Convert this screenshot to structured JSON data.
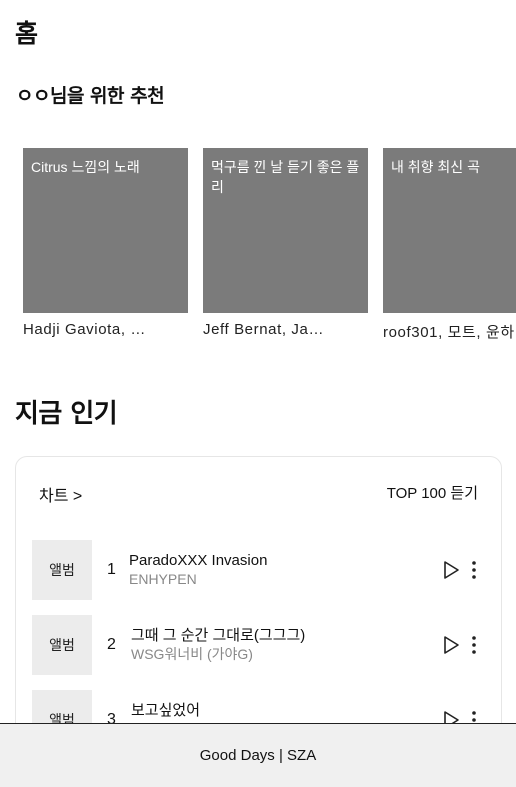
{
  "page": {
    "title": "홈"
  },
  "recommend": {
    "title": "ㅇㅇ님을 위한 추천",
    "cards": [
      {
        "cover_text": "Citrus 느낌의 노래",
        "artists": "Hadji Gaviota, Gentle Bones"
      },
      {
        "cover_text": "먹구름 낀 날 듣기 좋은 플리",
        "artists": "Jeff Bernat, Jack Johnson"
      },
      {
        "cover_text": "내 취향 최신 곡",
        "artists": "roof301, 모트, 윤하"
      }
    ]
  },
  "popular": {
    "title": "지금 인기",
    "chart_link": "차트 >",
    "top100_link": "TOP 100 듣기",
    "tracks": [
      {
        "thumb": "앨범",
        "rank": "1",
        "title": "ParadoXXX Invasion",
        "artist": "ENHYPEN"
      },
      {
        "thumb": "앨범",
        "rank": "2",
        "title": "그때 그 순간 그대로(그그그)",
        "artist": "WSG워너비 (가야G)"
      },
      {
        "thumb": "앨범",
        "rank": "3",
        "title": "보고싶었어",
        "artist": ""
      }
    ]
  },
  "player": {
    "now_playing": "Good Days | SZA"
  },
  "icons": {
    "play": "play-icon",
    "more": "more-vertical-icon"
  }
}
